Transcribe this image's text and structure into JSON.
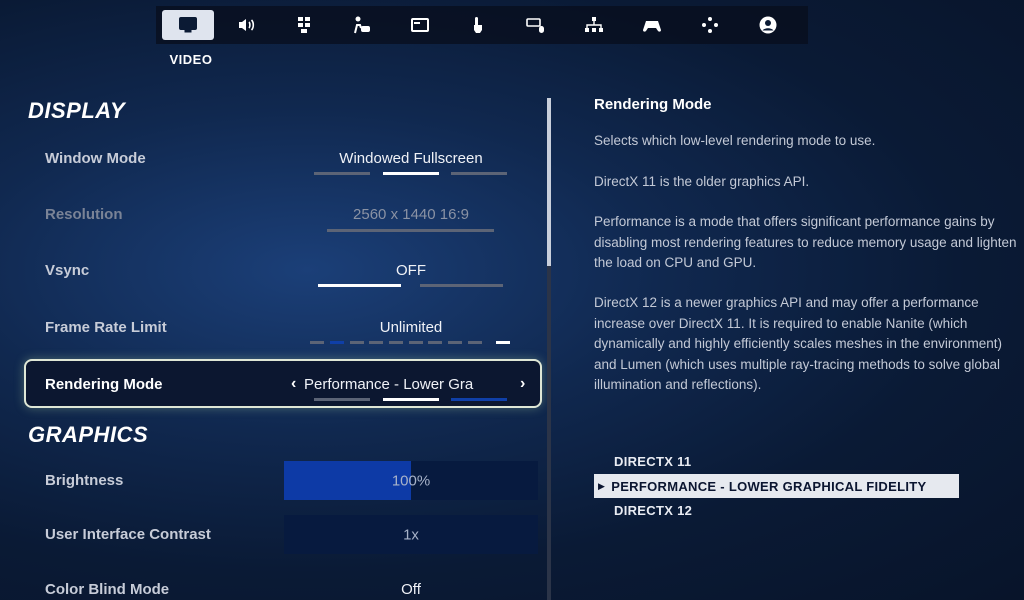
{
  "nav": {
    "active_tab_label": "VIDEO",
    "tabs": [
      {
        "icon": "monitor-icon",
        "active": true
      },
      {
        "icon": "speaker-icon",
        "active": false
      },
      {
        "icon": "accessibility-grid-icon",
        "active": false
      },
      {
        "icon": "controller-person-icon",
        "active": false
      },
      {
        "icon": "window-icon",
        "active": false
      },
      {
        "icon": "touch-icon",
        "active": false
      },
      {
        "icon": "keyboard-mouse-icon",
        "active": false
      },
      {
        "icon": "network-icon",
        "active": false
      },
      {
        "icon": "gamepad-icon",
        "active": false
      },
      {
        "icon": "dpad-icon",
        "active": false
      },
      {
        "icon": "account-icon",
        "active": false
      }
    ]
  },
  "display": {
    "title": "DISPLAY",
    "window_mode": {
      "label": "Window Mode",
      "value": "Windowed Fullscreen"
    },
    "resolution": {
      "label": "Resolution",
      "value": "2560 x 1440 16:9"
    },
    "vsync": {
      "label": "Vsync",
      "value": "OFF"
    },
    "frame_rate_limit": {
      "label": "Frame Rate Limit",
      "value": "Unlimited"
    },
    "rendering_mode": {
      "label": "Rendering Mode",
      "value": "Performance - Lower Gra"
    }
  },
  "graphics": {
    "title": "GRAPHICS",
    "brightness": {
      "label": "Brightness",
      "value": "100%",
      "level": 0.5
    },
    "ui_contrast": {
      "label": "User Interface Contrast",
      "value": "1x"
    },
    "color_blind_mode": {
      "label": "Color Blind Mode",
      "value": "Off"
    }
  },
  "description": {
    "title": "Rendering Mode",
    "paragraphs": [
      "Selects which low-level rendering mode to use.",
      "DirectX 11 is the older graphics API.",
      "Performance is a mode that offers significant performance gains by disabling most rendering features to reduce memory usage and lighten the load on CPU and GPU.",
      "DirectX 12 is a newer graphics API and may offer a performance increase over DirectX 11. It is required to enable Nanite (which dynamically and highly efficiently scales meshes in the environment) and Lumen (which uses multiple ray-tracing methods to solve global illumination and reflections)."
    ],
    "options": [
      "DIRECTX 11",
      "PERFORMANCE - LOWER GRAPHICAL FIDELITY",
      "DIRECTX 12"
    ],
    "selected_option": "PERFORMANCE - LOWER GRAPHICAL FIDELITY"
  },
  "colors": {
    "accent_blue": "#0d3aa6",
    "highlight_border": "#dfe7d6"
  }
}
